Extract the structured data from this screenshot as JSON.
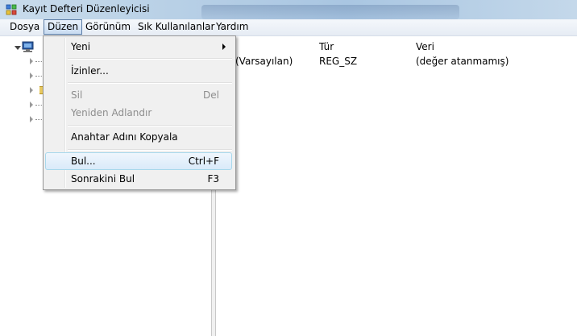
{
  "window": {
    "title": "Kayıt Defteri Düzenleyicisi",
    "app_icon": "registry-editor-icon"
  },
  "menubar": {
    "items": [
      "Dosya",
      "Düzen",
      "Görünüm",
      "Sık Kullanılanlar",
      "Yardım"
    ],
    "active": "Düzen"
  },
  "edit_menu": {
    "items": [
      {
        "label": "Yeni",
        "shortcut": "",
        "submenu": true,
        "enabled": true
      },
      {
        "label": "İzinler...",
        "shortcut": "",
        "submenu": false,
        "enabled": true
      },
      {
        "label": "Sil",
        "shortcut": "Del",
        "submenu": false,
        "enabled": false
      },
      {
        "label": "Yeniden Adlandır",
        "shortcut": "",
        "submenu": false,
        "enabled": false
      },
      {
        "label": "Anahtar Adını Kopyala",
        "shortcut": "",
        "submenu": false,
        "enabled": true
      },
      {
        "label": "Bul...",
        "shortcut": "Ctrl+F",
        "submenu": false,
        "enabled": true,
        "highlighted": true
      },
      {
        "label": "Sonrakini Bul",
        "shortcut": "F3",
        "submenu": false,
        "enabled": true
      }
    ]
  },
  "list": {
    "columns": [
      "Tür",
      "Veri"
    ],
    "rows": [
      {
        "name": "(Varsayılan)",
        "type": "REG_SZ",
        "data": "(değer atanmamış)"
      }
    ]
  },
  "colors": {
    "menu_highlight_border": "#a8d8eb",
    "menu_active_border": "#5a7ca6",
    "disabled_text": "#8d8d8d"
  }
}
